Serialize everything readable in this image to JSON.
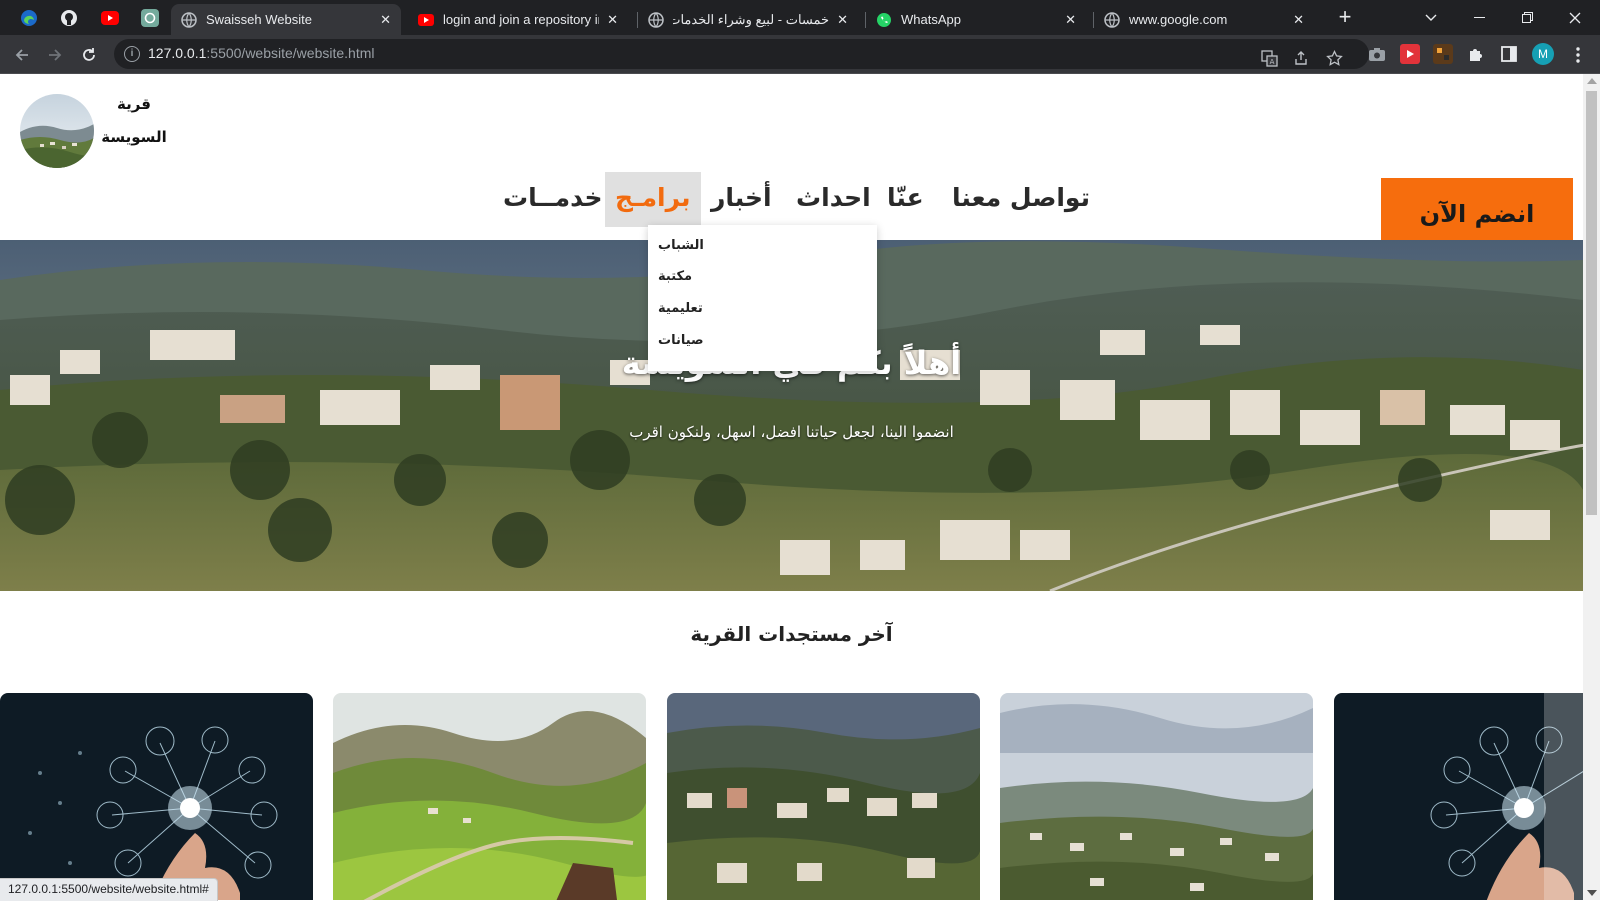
{
  "browser": {
    "tabs": [
      {
        "title": "Swaisseh Website",
        "active": true
      },
      {
        "title": "login and join a repository in",
        "active": false
      },
      {
        "title": "خمسات - لبيع وشراء الخدمات ال",
        "active": false
      },
      {
        "title": "WhatsApp",
        "active": false
      },
      {
        "title": "www.google.com",
        "active": false
      }
    ],
    "new_tab_label": "+",
    "url_host": "127.0.0.1",
    "url_path": ":5500/website/website.html",
    "profile_initial": "M",
    "status_url": "127.0.0.1:5500/website/website.html#"
  },
  "site": {
    "brand_line1": "قرية",
    "brand_line2": "السويسة",
    "nav": [
      {
        "label": "تواصل معنا"
      },
      {
        "label": "عنّا"
      },
      {
        "label": "احداث"
      },
      {
        "label": "أخبار"
      },
      {
        "label": "برامـج",
        "active": true
      },
      {
        "label": "خدمــات"
      }
    ],
    "join_button": "انضم الآن",
    "dropdown": [
      "الشباب",
      "مكتبة",
      "تعليمية",
      "صيانات"
    ],
    "hero_title": "أهلاً بكم في السويسة",
    "hero_subtitle": "انضموا الينا، لجعل حياتنا افضل، اسهل، ولنكون اقرب",
    "section_title": "آخر مستجدات القرية"
  },
  "colors": {
    "accent": "#f66d0d",
    "active_nav_text": "#f26b0f",
    "active_nav_bg": "#e0e0e0",
    "chrome_dark": "#202124",
    "chrome_toolbar": "#35363a"
  }
}
